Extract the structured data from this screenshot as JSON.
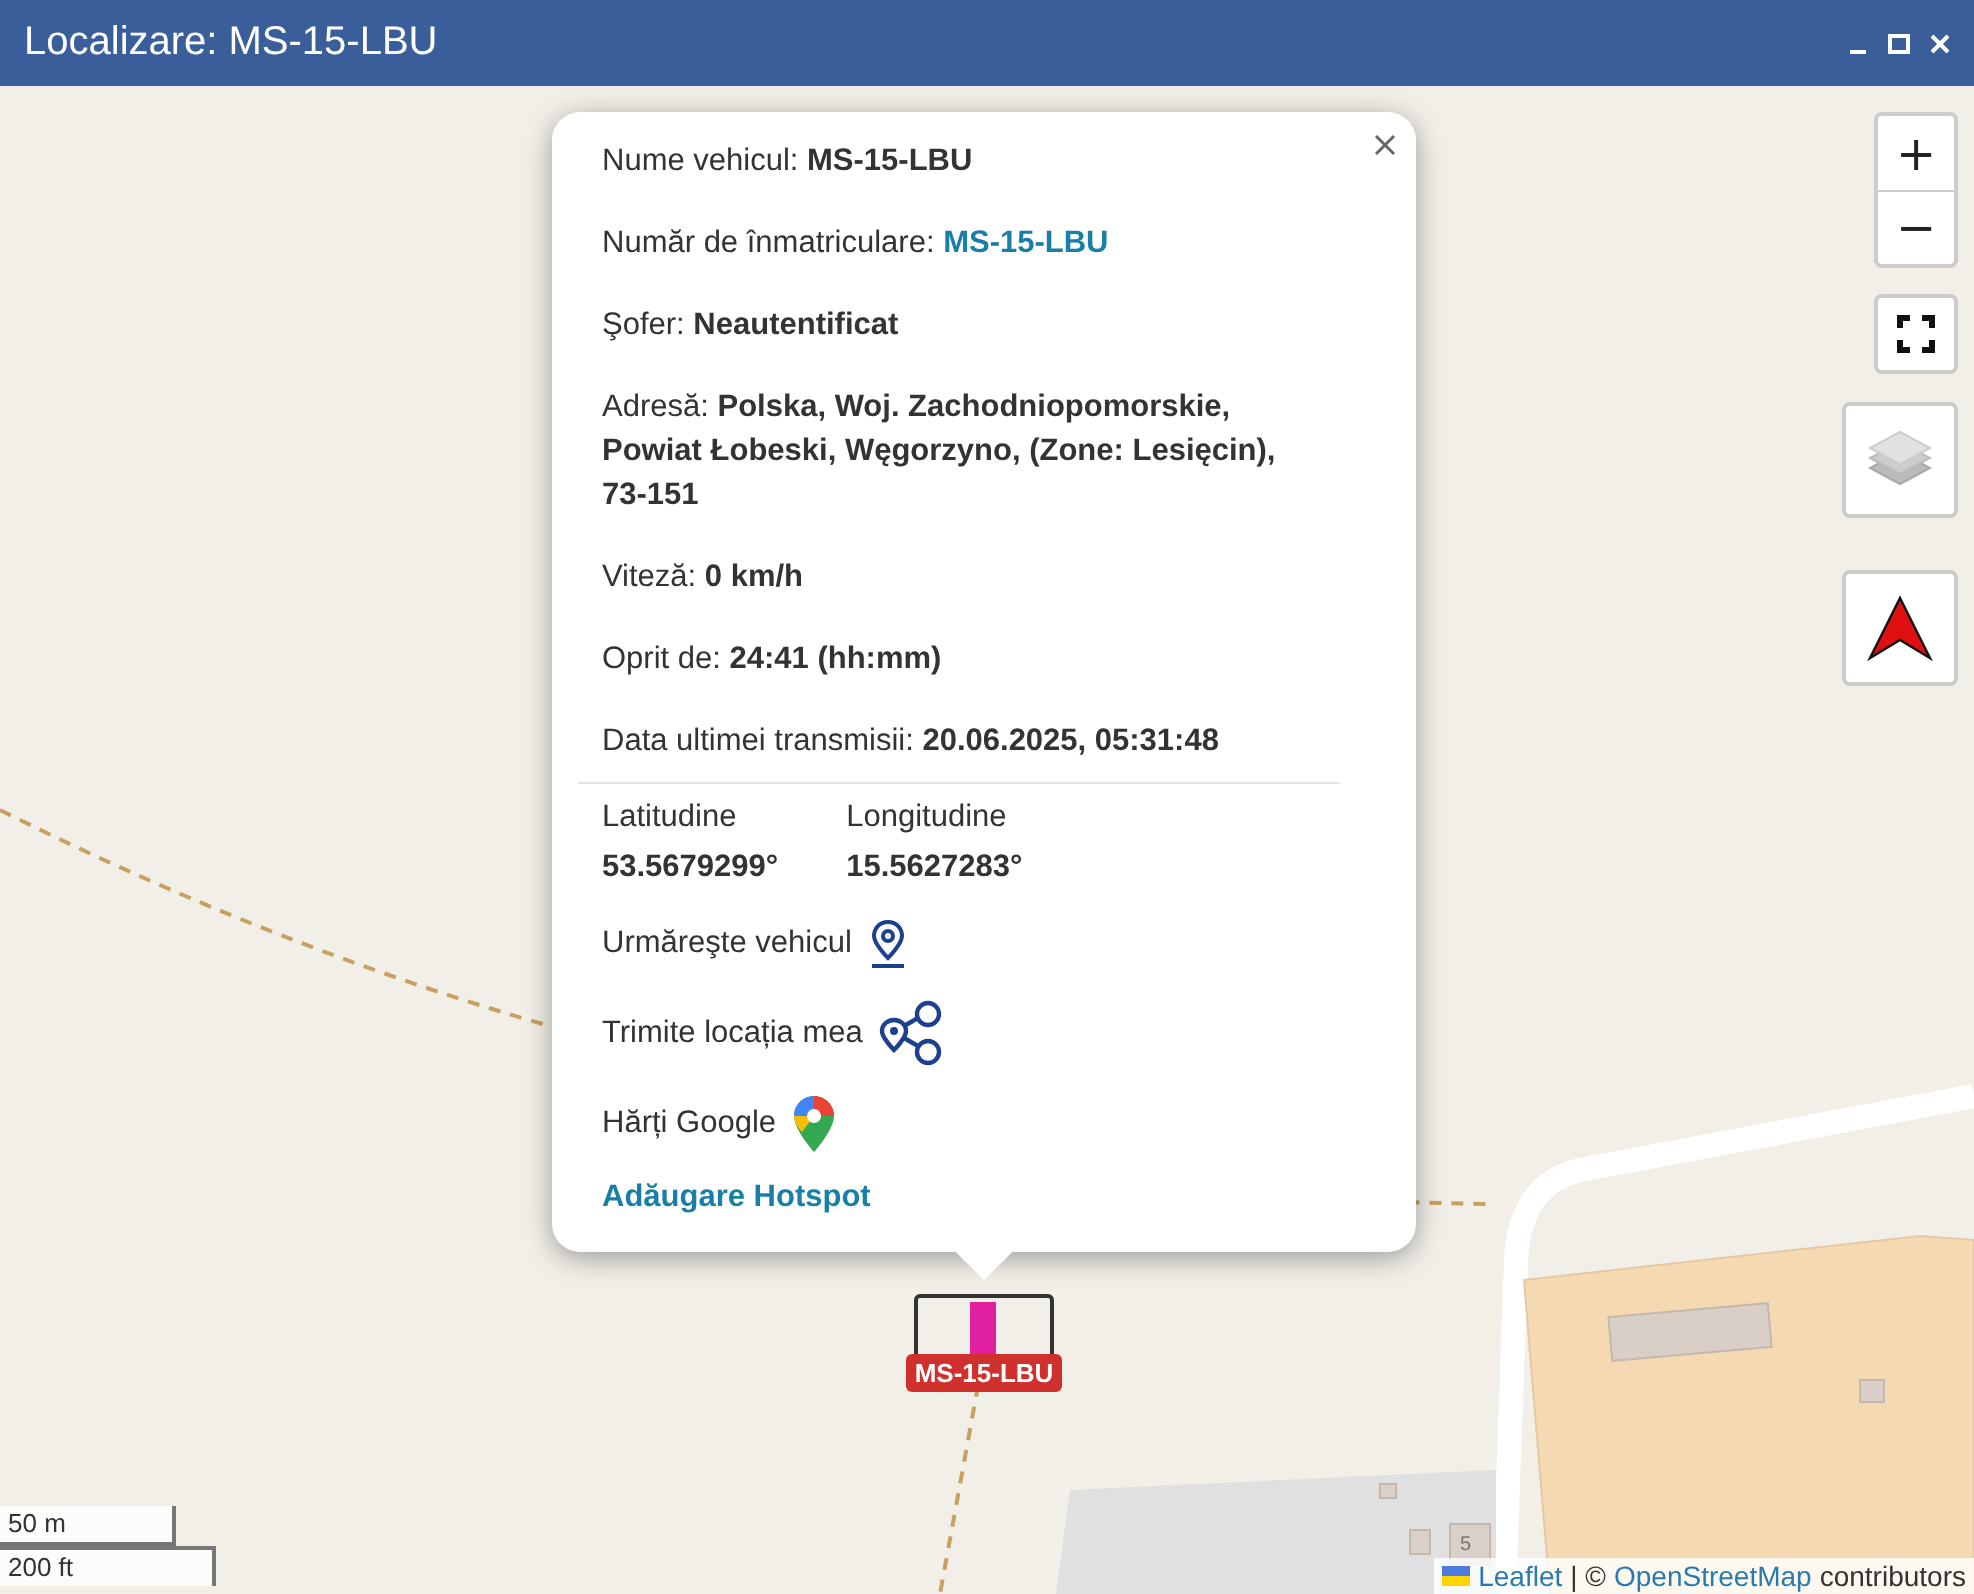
{
  "window": {
    "title": "Localizare: MS-15-LBU"
  },
  "popup": {
    "rows": [
      {
        "kind": "plain",
        "label": "Nume vehicul:",
        "value": "MS-15-LBU"
      },
      {
        "kind": "link",
        "label": "Număr de înmatriculare:",
        "value": "MS-15-LBU"
      },
      {
        "kind": "plain",
        "label": "Şofer:",
        "value": "Neautentificat"
      },
      {
        "kind": "plain",
        "label": "Adresă:",
        "value": "Polska, Woj. Zachodniopomorskie, Powiat Łobeski, Węgorzyno, (Zone: Lesięcin), 73-151"
      },
      {
        "kind": "plain",
        "label": "Viteză:",
        "value": "0 km/h"
      },
      {
        "kind": "plain",
        "label": "Oprit de:",
        "value": "24:41 (hh:mm)"
      },
      {
        "kind": "plain",
        "label": "Data ultimei transmisii:",
        "value": "20.06.2025, 05:31:48"
      }
    ],
    "coordinates": [
      {
        "label": "Latitudine",
        "value": "53.5679299°"
      },
      {
        "label": "Longitudine",
        "value": "15.5627283°"
      }
    ],
    "actions": [
      {
        "kind": "follow",
        "label": "Urmăreşte vehicul"
      },
      {
        "kind": "share",
        "label": "Trimite locația mea"
      },
      {
        "kind": "google",
        "label": "Hărți Google"
      }
    ],
    "hotspot_link": "Adăugare Hotspot"
  },
  "marker": {
    "label": "MS-15-LBU"
  },
  "map": {
    "house_number": "5",
    "zoom_in": "+",
    "zoom_out": "−",
    "scale": [
      "50 m",
      "200 ft"
    ],
    "attribution": {
      "leaflet": "Leaflet",
      "separator": "| ©",
      "osm": "OpenStreetMap",
      "suffix": "contributors"
    }
  }
}
